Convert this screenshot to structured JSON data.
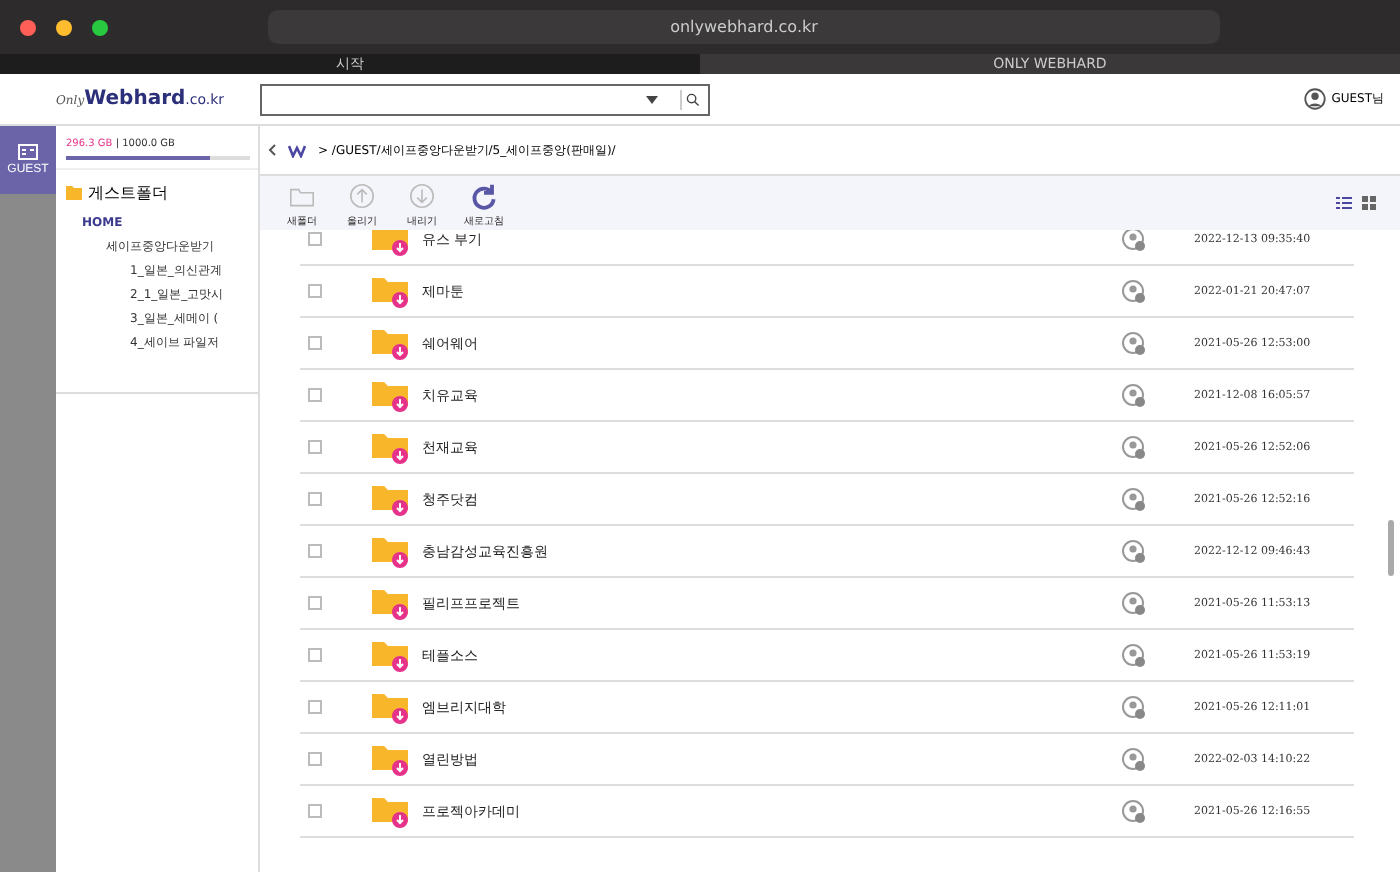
{
  "browser": {
    "url": "onlywebhard.co.kr",
    "tabs": [
      {
        "label": "시작",
        "selected": false
      },
      {
        "label": "ONLY WEBHARD",
        "selected": true
      }
    ]
  },
  "header": {
    "logo_script": "Only",
    "logo_main": "Webhard",
    "logo_suffix": ".co.kr",
    "user": "GUEST님"
  },
  "rail": {
    "label": "GUEST"
  },
  "storage": {
    "used": "296.3 GB",
    "separator": "|",
    "total": "1000.0 GB",
    "level": 0.78
  },
  "tree": {
    "root": "게스트폴더",
    "items": [
      {
        "label": "HOME",
        "children": [
          {
            "label": "세이프중앙다운받기",
            "children": [
              {
                "label": "1_일본_의신관계"
              },
              {
                "label": "2_1_일본_고맛시"
              },
              {
                "label": "3_일본_세메이 ("
              },
              {
                "label": "4_세이브 파일저"
              }
            ]
          }
        ]
      }
    ]
  },
  "breadcrumb": {
    "path": "> /GUEST/세이프중앙다운받기/5_세이프중앙(판매일)/"
  },
  "toolbar": [
    {
      "label": "새폴더",
      "kind": "folder"
    },
    {
      "label": "올리기",
      "kind": "upload"
    },
    {
      "label": "내리기",
      "kind": "download"
    },
    {
      "label": "새로고침",
      "kind": "refresh"
    }
  ],
  "files": [
    {
      "name": "유스 부기",
      "date": "2022-12-13 09:35:40",
      "checked": false
    },
    {
      "name": "제마툰",
      "date": "2022-01-21 20:47:07",
      "checked": false
    },
    {
      "name": "쉐어웨어",
      "date": "2021-05-26 12:53:00",
      "checked": false
    },
    {
      "name": "치유교육",
      "date": "2021-12-08 16:05:57",
      "checked": false
    },
    {
      "name": "천재교육",
      "date": "2021-05-26 12:52:06",
      "checked": false
    },
    {
      "name": "청주닷컴",
      "date": "2021-05-26 12:52:16",
      "checked": false
    },
    {
      "name": "충남감성교육진흥원",
      "date": "2022-12-12 09:46:43",
      "checked": false
    },
    {
      "name": "필리프프로젝트",
      "date": "2021-05-26 11:53:13",
      "checked": false
    },
    {
      "name": "테플소스",
      "date": "2021-05-26 11:53:19",
      "checked": false
    },
    {
      "name": "엠브리지대학",
      "date": "2021-05-26 12:11:01",
      "checked": false
    },
    {
      "name": "열린방법",
      "date": "2022-02-03 14:10:22",
      "checked": false
    },
    {
      "name": "프로젝아카데미",
      "date": "2021-05-26 12:16:55",
      "checked": false
    }
  ]
}
